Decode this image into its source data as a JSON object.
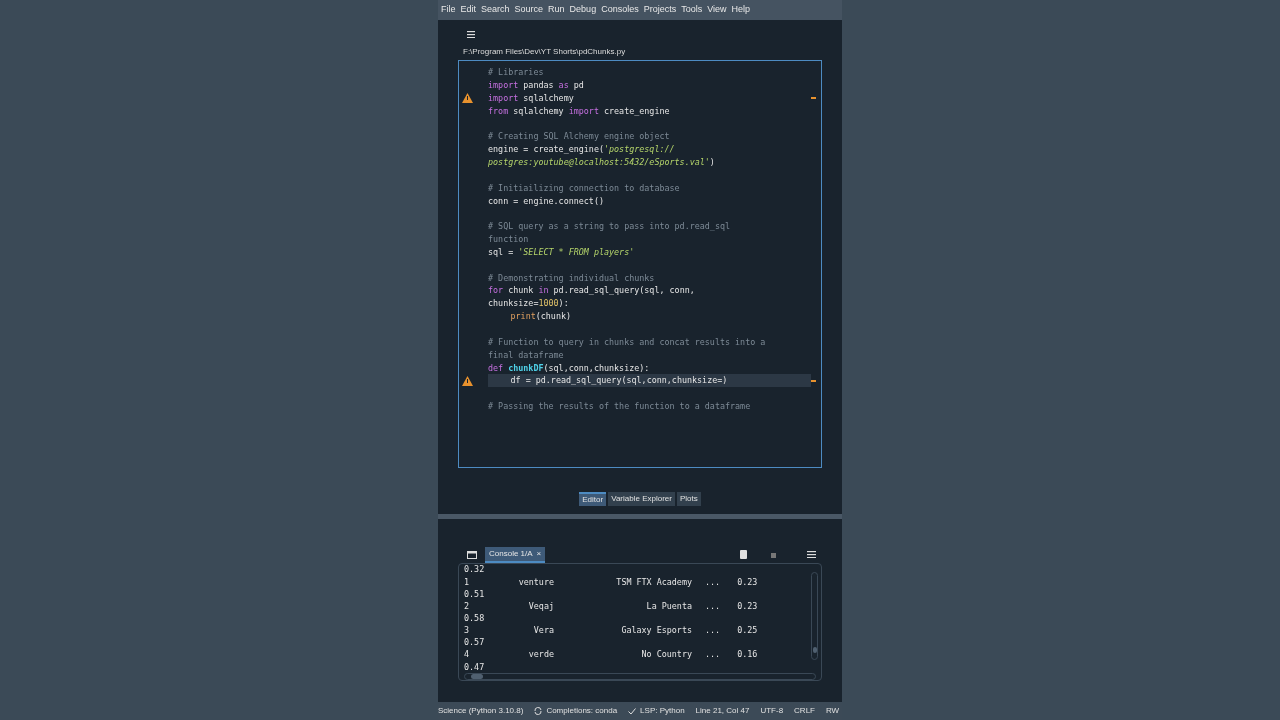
{
  "menu": [
    "File",
    "Edit",
    "Search",
    "Source",
    "Run",
    "Debug",
    "Consoles",
    "Projects",
    "Tools",
    "View",
    "Help"
  ],
  "file_path": "F:\\Program Files\\Dev\\YT Shorts\\pdChunks.py",
  "code_lines": [
    {
      "kind": "code",
      "indented": false,
      "warning": false,
      "current": false,
      "tokens": [
        {
          "kind": "comment",
          "text": "# Libraries"
        }
      ]
    },
    {
      "kind": "code",
      "indented": false,
      "warning": false,
      "current": false,
      "tokens": [
        {
          "kind": "keyword",
          "text": "import"
        },
        {
          "kind": "plain",
          "text": " pandas "
        },
        {
          "kind": "keyword",
          "text": "as"
        },
        {
          "kind": "plain",
          "text": " pd"
        }
      ]
    },
    {
      "kind": "code",
      "indented": false,
      "warning": true,
      "current": false,
      "tokens": [
        {
          "kind": "keyword",
          "text": "import"
        },
        {
          "kind": "plain",
          "text": " sqlalchemy"
        }
      ]
    },
    {
      "kind": "code",
      "indented": false,
      "warning": false,
      "current": false,
      "tokens": [
        {
          "kind": "keyword",
          "text": "from"
        },
        {
          "kind": "plain",
          "text": " sqlalchemy "
        },
        {
          "kind": "keyword",
          "text": "import"
        },
        {
          "kind": "plain",
          "text": " create_engine"
        }
      ]
    },
    {
      "kind": "blank"
    },
    {
      "kind": "code",
      "indented": false,
      "warning": false,
      "current": false,
      "tokens": [
        {
          "kind": "comment",
          "text": "# Creating SQL Alchemy engine object"
        }
      ]
    },
    {
      "kind": "code",
      "indented": false,
      "warning": false,
      "current": false,
      "tokens": [
        {
          "kind": "plain",
          "text": "engine = create_engine("
        },
        {
          "kind": "string",
          "text": "'postgresql://"
        }
      ]
    },
    {
      "kind": "code",
      "indented": false,
      "warning": false,
      "current": false,
      "tokens": [
        {
          "kind": "string",
          "text": "postgres:youtube@localhost:5432/eSports.val'"
        },
        {
          "kind": "plain",
          "text": ")"
        }
      ]
    },
    {
      "kind": "blank"
    },
    {
      "kind": "code",
      "indented": false,
      "warning": false,
      "current": false,
      "tokens": [
        {
          "kind": "comment",
          "text": "# Initiailizing connection to database"
        }
      ]
    },
    {
      "kind": "code",
      "indented": false,
      "warning": false,
      "current": false,
      "tokens": [
        {
          "kind": "plain",
          "text": "conn = engine.connect()"
        }
      ]
    },
    {
      "kind": "blank"
    },
    {
      "kind": "code",
      "indented": false,
      "warning": false,
      "current": false,
      "tokens": [
        {
          "kind": "comment",
          "text": "# SQL query as a string to pass into pd.read_sql"
        }
      ]
    },
    {
      "kind": "code",
      "indented": false,
      "warning": false,
      "current": false,
      "tokens": [
        {
          "kind": "comment",
          "text": "function"
        }
      ]
    },
    {
      "kind": "code",
      "indented": false,
      "warning": false,
      "current": false,
      "tokens": [
        {
          "kind": "plain",
          "text": "sql = "
        },
        {
          "kind": "string",
          "text": "'SELECT * FROM players'"
        }
      ]
    },
    {
      "kind": "blank"
    },
    {
      "kind": "code",
      "indented": false,
      "warning": false,
      "current": false,
      "tokens": [
        {
          "kind": "comment",
          "text": "# Demonstrating individual chunks"
        }
      ]
    },
    {
      "kind": "code",
      "indented": false,
      "warning": false,
      "current": false,
      "tokens": [
        {
          "kind": "keyword",
          "text": "for"
        },
        {
          "kind": "plain",
          "text": " chunk "
        },
        {
          "kind": "keyword",
          "text": "in"
        },
        {
          "kind": "plain",
          "text": " pd.read_sql_query(sql, conn,"
        }
      ]
    },
    {
      "kind": "code",
      "indented": false,
      "warning": false,
      "current": false,
      "tokens": [
        {
          "kind": "plain",
          "text": "chunksize="
        },
        {
          "kind": "number",
          "text": "1000"
        },
        {
          "kind": "plain",
          "text": "):"
        }
      ]
    },
    {
      "kind": "code",
      "indented": true,
      "warning": false,
      "current": false,
      "tokens": [
        {
          "kind": "builtin",
          "text": "print"
        },
        {
          "kind": "plain",
          "text": "(chunk)"
        }
      ]
    },
    {
      "kind": "blank"
    },
    {
      "kind": "code",
      "indented": false,
      "warning": false,
      "current": false,
      "tokens": [
        {
          "kind": "comment",
          "text": "# Function to query in chunks and concat results into a"
        }
      ]
    },
    {
      "kind": "code",
      "indented": false,
      "warning": false,
      "current": false,
      "tokens": [
        {
          "kind": "comment",
          "text": "final dataframe"
        }
      ]
    },
    {
      "kind": "code",
      "indented": false,
      "warning": false,
      "current": false,
      "tokens": [
        {
          "kind": "keyword",
          "text": "def "
        },
        {
          "kind": "function",
          "text": "chunkDF"
        },
        {
          "kind": "plain",
          "text": "(sql,conn,chunksize):"
        }
      ]
    },
    {
      "kind": "code",
      "indented": true,
      "warning": true,
      "current": true,
      "tokens": [
        {
          "kind": "plain",
          "text": "df = pd.read_sql_query(sql,conn,chunksize=)"
        }
      ]
    },
    {
      "kind": "blank"
    },
    {
      "kind": "code",
      "indented": false,
      "warning": false,
      "current": false,
      "tokens": [
        {
          "kind": "comment",
          "text": "# Passing the results of the function to a dataframe"
        }
      ]
    }
  ],
  "pane_tabs": [
    {
      "label": "Editor",
      "selected": true
    },
    {
      "label": "Variable Explorer",
      "selected": false
    },
    {
      "label": "Plots",
      "selected": false
    }
  ],
  "console_tab": {
    "label": "Console 1/A",
    "close": "×"
  },
  "console_lines": [
    {
      "kind": "value",
      "text": "0.32"
    },
    {
      "kind": "row",
      "index": "1",
      "name": "venture",
      "team": "TSM FTX Academy",
      "ellipsis": "...",
      "value": "0.23"
    },
    {
      "kind": "value",
      "text": "0.51"
    },
    {
      "kind": "row",
      "index": "2",
      "name": "Veqaj",
      "team": "La Puenta",
      "ellipsis": "...",
      "value": "0.23"
    },
    {
      "kind": "value",
      "text": "0.58"
    },
    {
      "kind": "row",
      "index": "3",
      "name": "Vera",
      "team": "Galaxy Esports",
      "ellipsis": "...",
      "value": "0.25"
    },
    {
      "kind": "value",
      "text": "0.57"
    },
    {
      "kind": "row",
      "index": "4",
      "name": "verde",
      "team": "No Country",
      "ellipsis": "...",
      "value": "0.16"
    },
    {
      "kind": "value",
      "text": "0.47"
    }
  ],
  "status_bar": {
    "env": "Science (Python 3.10.8)",
    "completions": "Completions: conda",
    "lsp": "LSP: Python",
    "position": "Line 21, Col 47",
    "encoding": "UTF-8",
    "eol": "CRLF",
    "mode": "RW"
  }
}
